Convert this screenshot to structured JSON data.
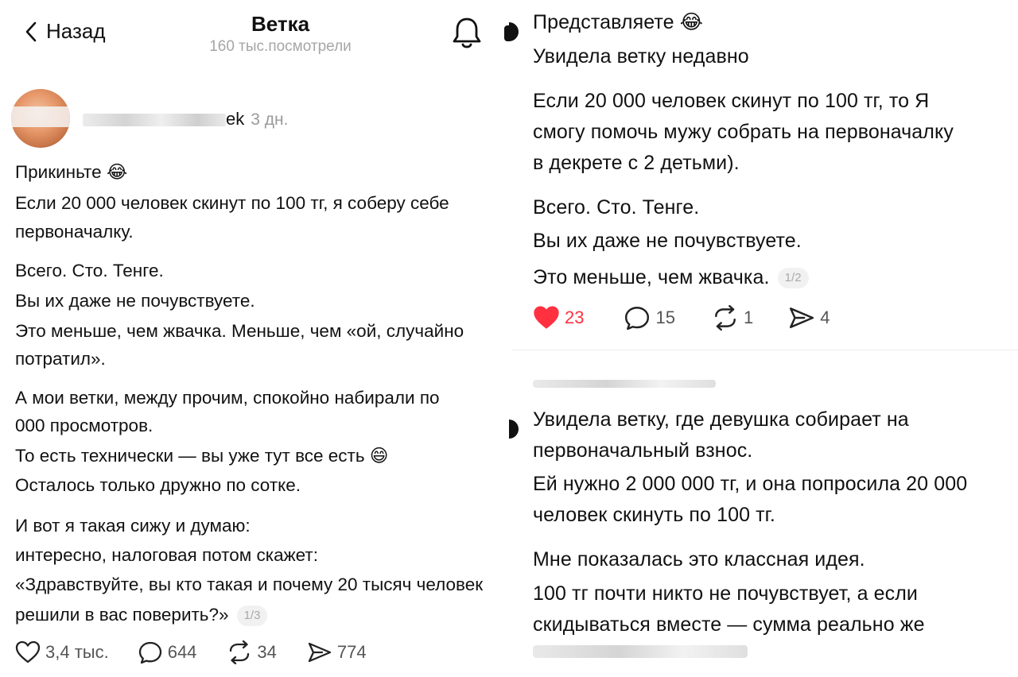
{
  "left": {
    "header": {
      "back_label": "Назад",
      "title": "Ветка",
      "views": "160 тыс.посмотрели"
    },
    "post": {
      "username_visible": "ek",
      "time": "3 дн.",
      "lines": [
        "Прикиньте 😂",
        "Если 20 000 человек скинут по 100 тг, я соберу себе",
        "первоначалку.",
        "Всего. Сто. Тенге.",
        "Вы их даже не почувствуете.",
        "Это меньше, чем жвачка. Меньше, чем «ой, случайно",
        "потратил».",
        "А мои ветки, между прочим, спокойно набирали по",
        "000 просмотров.",
        "То есть технически — вы уже тут все есть 😄",
        "Осталось только дружно по сотке.",
        "И вот я такая сижу и думаю:",
        "интересно, налоговая потом скажет:",
        "«Здравствуйте, вы кто такая и почему 20 тысяч человек",
        "решили в вас поверить?»"
      ],
      "page_badge": "1/3",
      "likes": "3,4 тыс.",
      "comments": "644",
      "reposts": "34",
      "shares": "774"
    }
  },
  "right": {
    "post1": {
      "lines": [
        "Представляете 😂",
        "Увидела ветку недавно",
        "Если 20 000 человек скинут по 100 тг, то Я",
        "смогу помочь мужу собрать на первоначалку",
        "в декрете с 2 детьми).",
        "Всего. Сто. Тенге.",
        "Вы их даже не почувствуете.",
        "Это меньше, чем жвачка."
      ],
      "page_badge": "1/2",
      "likes": "23",
      "comments": "15",
      "reposts": "1",
      "shares": "4"
    },
    "post2": {
      "lines": [
        "Увидела ветку, где девушка собирает на",
        "первоначальный взнос.",
        "Ей нужно 2 000 000 тг, и она попросила 20 000",
        "человек скинуть по 100 тг.",
        "Мне показалась это классная идея.",
        "100 тг почти никто не почувствует, а если",
        "скидываться вместе — сумма реально же"
      ]
    }
  },
  "colors": {
    "like_red": "#ff3040",
    "muted": "#9a9a9a",
    "icon": "#222222"
  },
  "icons": {
    "back": "chevron-left-icon",
    "bell": "bell-icon",
    "heart": "heart-icon",
    "comment": "comment-icon",
    "repost": "repost-icon",
    "share": "share-icon"
  }
}
